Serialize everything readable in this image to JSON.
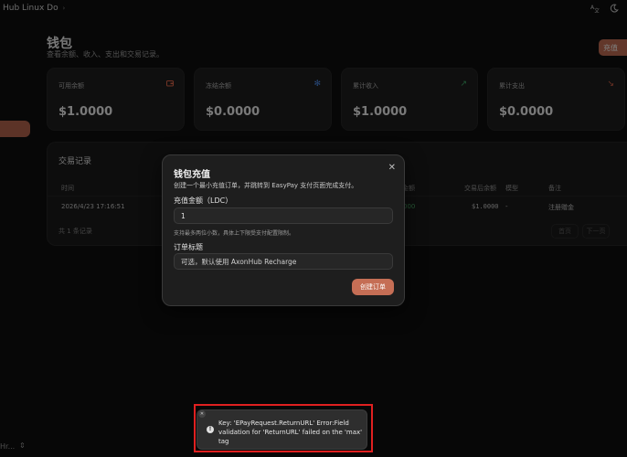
{
  "header": {
    "brand": "Hub Linux Do",
    "icons": [
      "chevron-icon",
      "translate-icon",
      "theme-moon-icon"
    ]
  },
  "sidebar": {
    "footer_text": "Hr..."
  },
  "page": {
    "title": "钱包",
    "subtitle": "查看余额、收入、支出和交易记录。",
    "recharge_label": "充值"
  },
  "stats": [
    {
      "label": "可用余额",
      "value": "$1.0000",
      "icon": "wallet-icon",
      "color": "#e0664a"
    },
    {
      "label": "冻结余额",
      "value": "$0.0000",
      "icon": "snowflake-icon",
      "color": "#4f8ff0"
    },
    {
      "label": "累计收入",
      "value": "$1.0000",
      "icon": "arrow-up-right-icon",
      "color": "#3fae6a"
    },
    {
      "label": "累计支出",
      "value": "$0.0000",
      "icon": "arrow-down-right-icon",
      "color": "#e0664a"
    }
  ],
  "transactions": {
    "title": "交易记录",
    "columns": [
      "时间",
      "金额",
      "交易后余额",
      "模型",
      "备注"
    ],
    "rows": [
      {
        "time": "2026/4/23 17:16:51",
        "amount": "000",
        "balance_after": "$1.0000",
        "model": "-",
        "note": "注册赠金"
      }
    ],
    "count_text": "共 1 条记录",
    "prev_label": "首页",
    "next_label": "下一页"
  },
  "modal": {
    "title": "钱包充值",
    "description": "创建一个最小充值订单，并跳转到 EasyPay 支付页面完成支付。",
    "amount_label": "充值金额（LDC）",
    "amount_value": "1",
    "amount_hint": "支持最多两位小数，具体上下限受支付配置限制。",
    "subject_label": "订单标题",
    "subject_placeholder": "可选，默认使用 AxonHub Recharge",
    "create_label": "创建订单"
  },
  "toast": {
    "message": "Key: 'EPayRequest.ReturnURL' Error:Field validation for 'ReturnURL' failed on the 'max' tag"
  }
}
